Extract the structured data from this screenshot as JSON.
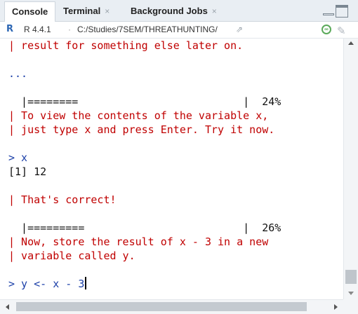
{
  "tabs": [
    {
      "label": "Console",
      "closable": false,
      "active": true
    },
    {
      "label": "Terminal",
      "closable": true,
      "active": false
    },
    {
      "label": "Background Jobs",
      "closable": true,
      "active": false
    }
  ],
  "close_glyph": "×",
  "info": {
    "r_logo": "R",
    "r_version": "R 4.4.1",
    "separator": "·",
    "path": "C:/Studies/7SEM/THREATHUNTING/",
    "share_glyph": "⇗",
    "wd_icon_glyph": "∞",
    "broom_glyph": "🧹"
  },
  "console": {
    "lines": [
      "| result for something else later on.",
      "...",
      "  |========                          |  24%",
      "| To view the contents of the variable x,",
      "| just type x and press Enter. Try it now.",
      "> x",
      "[1] 12",
      "| That's correct!",
      "  |=========                         |  26%",
      "| Now, store the result of x - 3 in a new",
      "| variable called y."
    ],
    "current_input": "> y <- x - 3"
  },
  "colors": {
    "message": "#c00000",
    "input": "#1b3fa8",
    "output": "#111111"
  }
}
